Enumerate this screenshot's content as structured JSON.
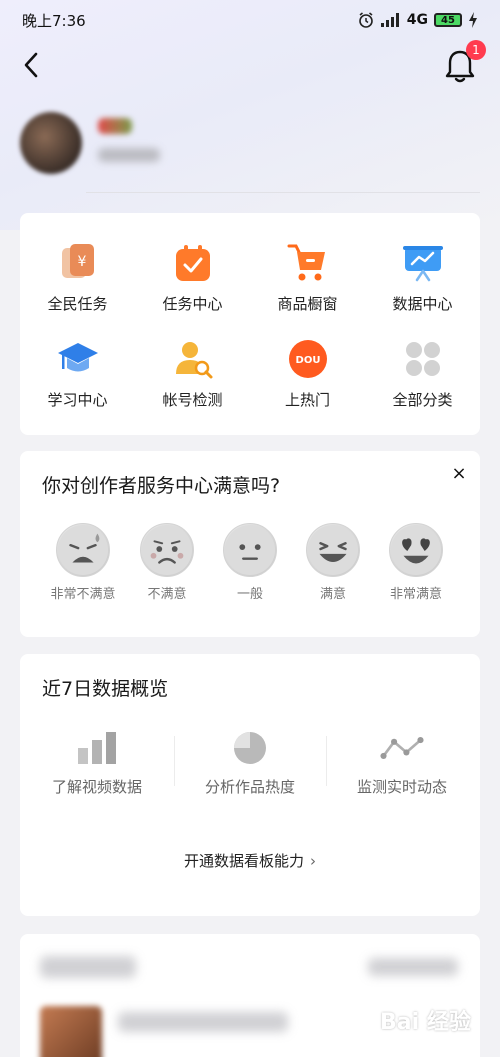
{
  "status_bar": {
    "time": "晚上7:36",
    "network": "4G",
    "battery": "45"
  },
  "notifications": {
    "badge_count": "1"
  },
  "tools": [
    {
      "label": "全民任务",
      "icon": "coupon-yen-icon"
    },
    {
      "label": "任务中心",
      "icon": "task-calendar-icon"
    },
    {
      "label": "商品橱窗",
      "icon": "shopping-cart-icon"
    },
    {
      "label": "数据中心",
      "icon": "data-board-icon"
    },
    {
      "label": "学习中心",
      "icon": "graduation-cap-icon"
    },
    {
      "label": "帐号检测",
      "icon": "account-check-icon"
    },
    {
      "label": "上热门",
      "icon": "dou-plus-icon"
    },
    {
      "label": "全部分类",
      "icon": "all-categories-icon"
    }
  ],
  "survey": {
    "title": "你对创作者服务中心满意吗?",
    "close": "×",
    "options": [
      {
        "label": "非常不满意"
      },
      {
        "label": "不满意"
      },
      {
        "label": "一般"
      },
      {
        "label": "满意"
      },
      {
        "label": "非常满意"
      }
    ]
  },
  "data_overview": {
    "title": "近7日数据概览",
    "items": [
      {
        "label": "了解视频数据",
        "icon": "bar-chart-icon"
      },
      {
        "label": "分析作品热度",
        "icon": "pie-chart-icon"
      },
      {
        "label": "监测实时动态",
        "icon": "line-trend-icon"
      }
    ],
    "link": "开通数据看板能力",
    "link_chevron": "›"
  },
  "watermark": "Bai 经验"
}
